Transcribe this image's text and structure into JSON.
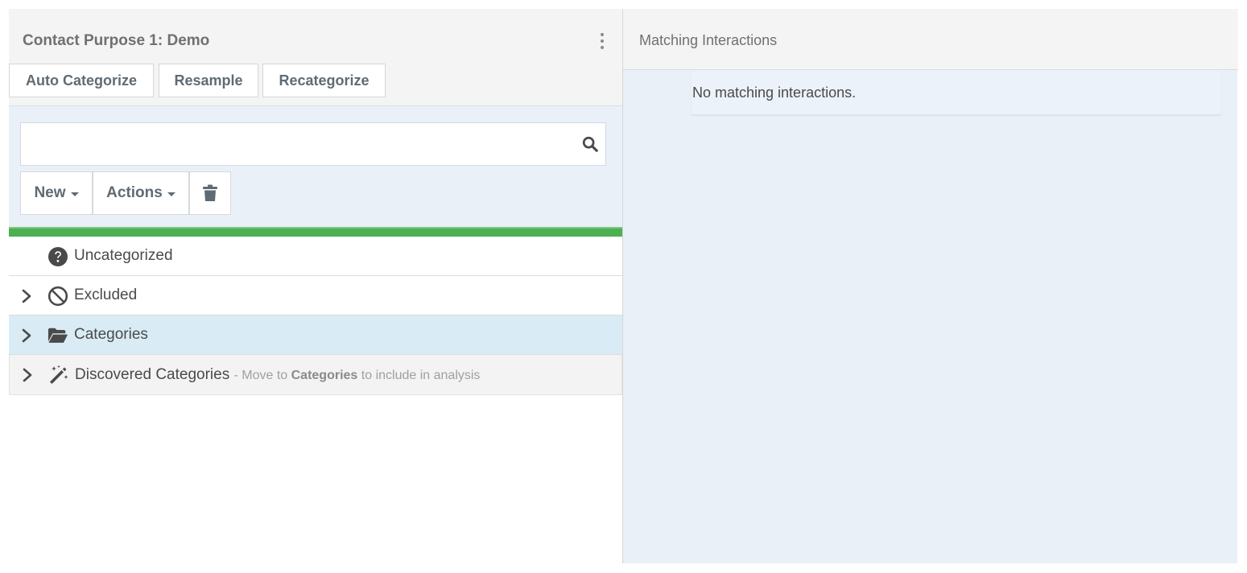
{
  "left_panel": {
    "title": "Contact Purpose 1: Demo",
    "header_buttons": {
      "auto_categorize": "Auto Categorize",
      "resample": "Resample",
      "recategorize": "Recategorize"
    },
    "search": {
      "value": "",
      "placeholder": ""
    },
    "toolbar": {
      "new_label": "New",
      "actions_label": "Actions"
    },
    "progress": {
      "percent": 100,
      "color": "#4caf50"
    },
    "tree": [
      {
        "label": "Uncategorized",
        "icon": "question-circle-icon",
        "expandable": false,
        "selected": false
      },
      {
        "label": "Excluded",
        "icon": "ban-icon",
        "expandable": true,
        "selected": false
      },
      {
        "label": "Categories",
        "icon": "folder-open-icon",
        "expandable": true,
        "selected": true
      },
      {
        "label": "Discovered Categories",
        "icon": "magic-wand-icon",
        "expandable": true,
        "selected": false,
        "note_prefix": "- Move to",
        "note_strong": "Categories",
        "note_suffix": "to include in analysis"
      }
    ]
  },
  "right_panel": {
    "title": "Matching Interactions",
    "empty_message": "No matching interactions."
  },
  "colors": {
    "panel_header_bg": "#f4f4f4",
    "filter_bg": "#e9f0f8",
    "selected_row_bg": "#d9ecf5",
    "button_text": "#5f6b74"
  }
}
